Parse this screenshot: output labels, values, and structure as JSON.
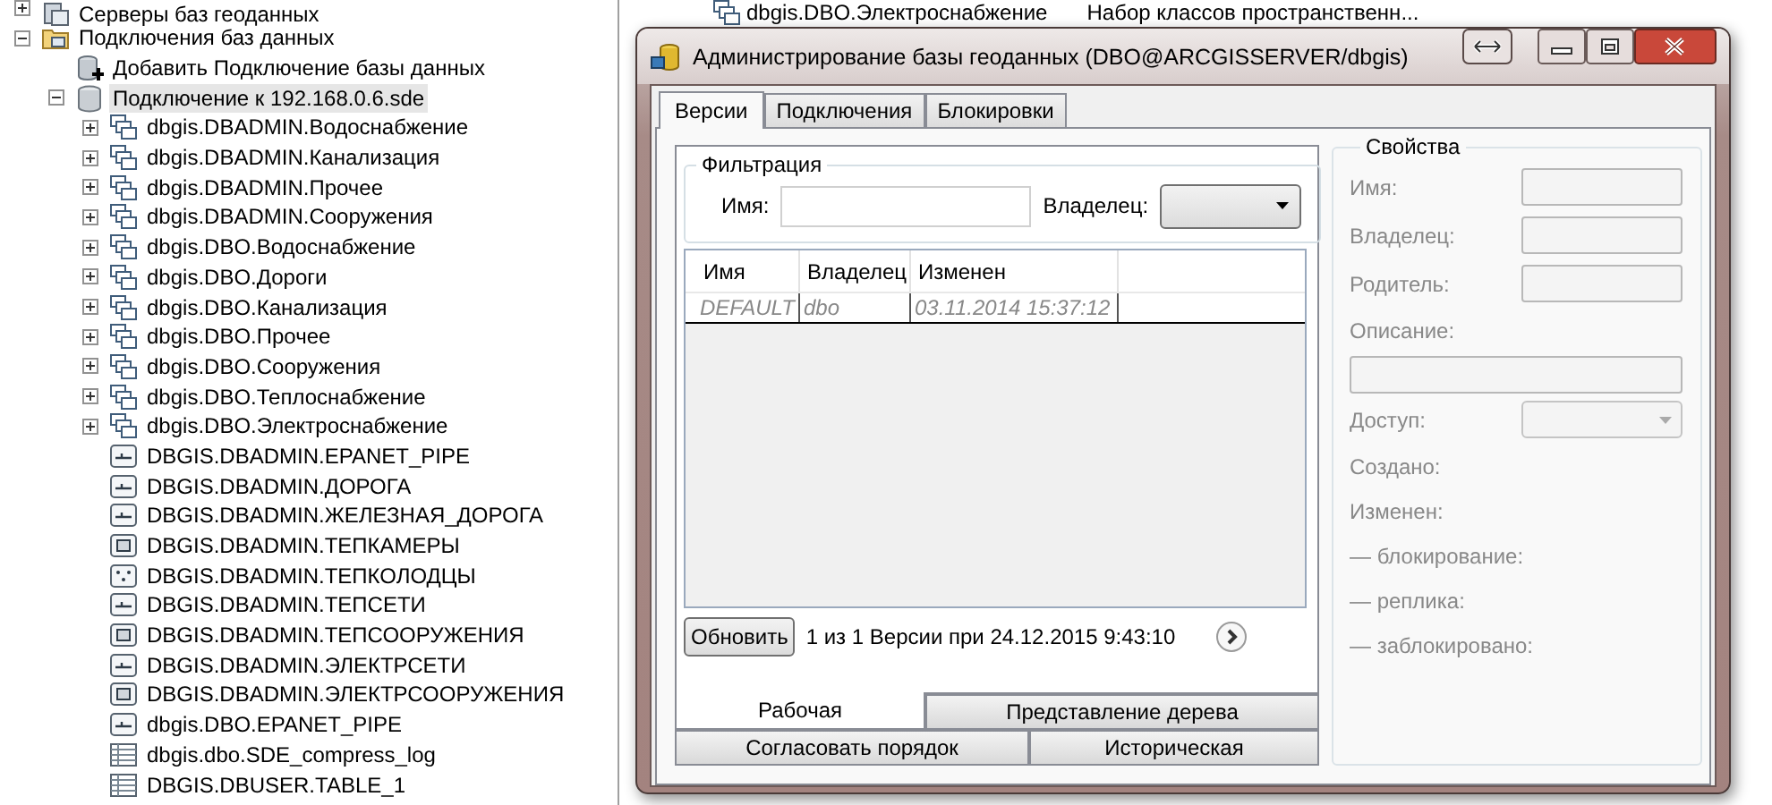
{
  "tree": {
    "items": [
      {
        "label": "Серверы баз геоданных",
        "kind": "servers",
        "expanded": false,
        "selected": false
      },
      {
        "label": "Подключения баз данных",
        "kind": "folder",
        "expanded": true,
        "selected": false,
        "children": [
          {
            "label": "Добавить Подключение базы данных",
            "kind": "add-connection",
            "selected": false
          },
          {
            "label": "Подключение к 192.168.0.6.sde",
            "kind": "database",
            "expanded": true,
            "selected": true,
            "children": [
              {
                "label": "dbgis.DBADMIN.Водоснабжение",
                "kind": "dataset",
                "expanded": false,
                "selected": false
              },
              {
                "label": "dbgis.DBADMIN.Канализация",
                "kind": "dataset",
                "expanded": false,
                "selected": false
              },
              {
                "label": "dbgis.DBADMIN.Прочее",
                "kind": "dataset",
                "expanded": false,
                "selected": false
              },
              {
                "label": "dbgis.DBADMIN.Сооружения",
                "kind": "dataset",
                "expanded": false,
                "selected": false
              },
              {
                "label": "dbgis.DBO.Водоснабжение",
                "kind": "dataset",
                "expanded": false,
                "selected": false
              },
              {
                "label": "dbgis.DBO.Дороги",
                "kind": "dataset",
                "expanded": false,
                "selected": false
              },
              {
                "label": "dbgis.DBO.Канализация",
                "kind": "dataset",
                "expanded": false,
                "selected": false
              },
              {
                "label": "dbgis.DBO.Прочее",
                "kind": "dataset",
                "expanded": false,
                "selected": false
              },
              {
                "label": "dbgis.DBO.Сооружения",
                "kind": "dataset",
                "expanded": false,
                "selected": false
              },
              {
                "label": "dbgis.DBO.Теплоснабжение",
                "kind": "dataset",
                "expanded": false,
                "selected": false
              },
              {
                "label": "dbgis.DBO.Электроснабжение",
                "kind": "dataset",
                "expanded": false,
                "selected": false
              },
              {
                "label": "DBGIS.DBADMIN.EPANET_PIPE",
                "kind": "line",
                "selected": false
              },
              {
                "label": "DBGIS.DBADMIN.ДОРОГА",
                "kind": "line",
                "selected": false
              },
              {
                "label": "DBGIS.DBADMIN.ЖЕЛЕЗНАЯ_ДОРОГА",
                "kind": "line",
                "selected": false
              },
              {
                "label": "DBGIS.DBADMIN.ТЕПКАМЕРЫ",
                "kind": "polygon",
                "selected": false
              },
              {
                "label": "DBGIS.DBADMIN.ТЕПКОЛОДЦЫ",
                "kind": "point",
                "selected": false
              },
              {
                "label": "DBGIS.DBADMIN.ТЕПСЕТИ",
                "kind": "line",
                "selected": false
              },
              {
                "label": "DBGIS.DBADMIN.ТЕПСООРУЖЕНИЯ",
                "kind": "polygon",
                "selected": false
              },
              {
                "label": "DBGIS.DBADMIN.ЭЛЕКТРСЕТИ",
                "kind": "line",
                "selected": false
              },
              {
                "label": "DBGIS.DBADMIN.ЭЛЕКТРСООРУЖЕНИЯ",
                "kind": "polygon",
                "selected": false
              },
              {
                "label": "dbgis.DBO.EPANET_PIPE",
                "kind": "line",
                "selected": false
              },
              {
                "label": "dbgis.dbo.SDE_compress_log",
                "kind": "table",
                "selected": false
              },
              {
                "label": "DBGIS.DBUSER.TABLE_1",
                "kind": "table",
                "selected": false
              }
            ]
          }
        ]
      }
    ]
  },
  "contents_row": {
    "name": "dbgis.DBO.Электроснабжение",
    "type": "Набор классов пространственн..."
  },
  "dialog": {
    "title": "Администрирование базы геоданных (DBO@ARCGISSERVER/dbgis)",
    "tabs": [
      {
        "label": "Версии",
        "selected": true
      },
      {
        "label": "Подключения",
        "selected": false
      },
      {
        "label": "Блокировки",
        "selected": false
      }
    ],
    "filter": {
      "title": "Фильтрация",
      "name_label": "Имя:",
      "owner_label": "Владелец:"
    },
    "table": {
      "columns": [
        "Имя",
        "Владелец",
        "Изменен"
      ],
      "rows": [
        {
          "cells": [
            "DEFAULT",
            "dbo",
            "03.11.2014 15:37:12"
          ]
        }
      ]
    },
    "refresh_button": "Обновить",
    "status": "1 из 1 Версии при 24.12.2015 9:43:10",
    "view_tabs": [
      [
        {
          "label": "Рабочая",
          "selected": true
        },
        {
          "label": "Представление дерева",
          "selected": false
        }
      ],
      [
        {
          "label": "Согласовать порядок",
          "selected": false
        },
        {
          "label": "Историческая",
          "selected": false
        }
      ]
    ],
    "properties": {
      "title": "Свойства",
      "rows": [
        {
          "kind": "field",
          "label": "Имя:"
        },
        {
          "kind": "field",
          "label": "Владелец:"
        },
        {
          "kind": "field",
          "label": "Родитель:"
        },
        {
          "kind": "label",
          "label": "Описание:"
        },
        {
          "kind": "wide"
        },
        {
          "kind": "combo",
          "label": "Доступ:"
        },
        {
          "kind": "label",
          "label": "Создано:"
        },
        {
          "kind": "label",
          "label": "Изменен:"
        },
        {
          "kind": "label",
          "label": "— блокирование:"
        },
        {
          "kind": "label",
          "label": "— реплика:"
        },
        {
          "kind": "label",
          "label": "— заблокировано:"
        }
      ]
    }
  }
}
